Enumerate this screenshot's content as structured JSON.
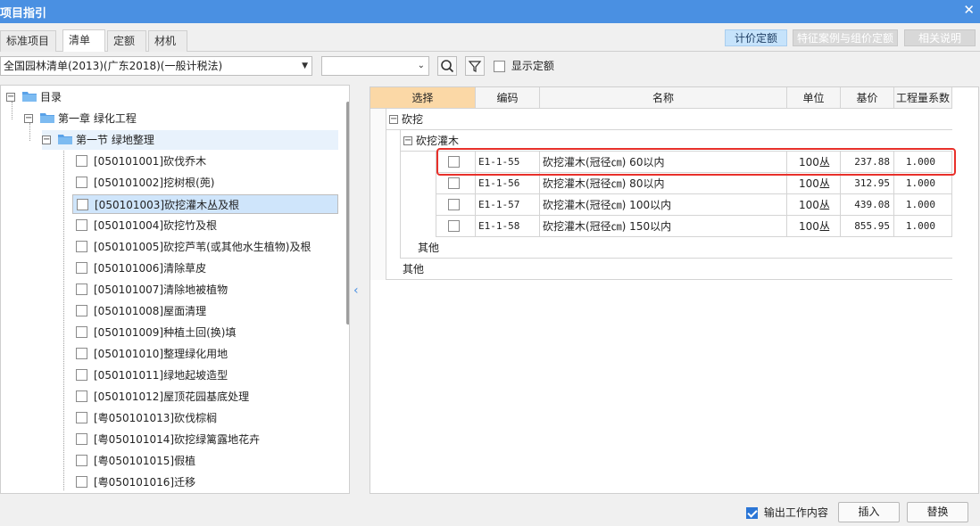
{
  "window": {
    "title": "项目指引",
    "close_icon": "close-icon"
  },
  "tabs": [
    {
      "label": "标准项目",
      "active": false
    },
    {
      "label": "清单",
      "active": true
    },
    {
      "label": "定额",
      "active": false
    },
    {
      "label": "材机",
      "active": false
    }
  ],
  "top_buttons": [
    {
      "label": "计价定额",
      "active": true
    },
    {
      "label": "特征案例与组价定额",
      "active": false
    },
    {
      "label": "相关说明",
      "active": false
    }
  ],
  "toolbar": {
    "library_select": "全国园林清单(2013)(广东2018)(一般计税法)",
    "secondary_select": "",
    "search_icon": "search-icon",
    "filter_icon": "filter-icon",
    "show_quota_label": "显示定额",
    "show_quota_checked": false
  },
  "tree": {
    "root": "目录",
    "chapter": "第一章 绿化工程",
    "section": "第一节 绿地整理",
    "items": [
      "[050101001]砍伐乔木",
      "[050101002]挖树根(蔸)",
      "[050101003]砍挖灌木丛及根",
      "[050101004]砍挖竹及根",
      "[050101005]砍挖芦苇(或其他水生植物)及根",
      "[050101006]清除草皮",
      "[050101007]清除地被植物",
      "[050101008]屋面清理",
      "[050101009]种植土回(换)填",
      "[050101010]整理绿化用地",
      "[050101011]绿地起坡造型",
      "[050101012]屋顶花园基底处理",
      "[粤050101013]砍伐棕榈",
      "[粤050101014]砍挖绿篱露地花卉",
      "[粤050101015]假植",
      "[粤050101016]迁移"
    ],
    "selected_index": 2
  },
  "grid": {
    "columns": [
      "选择",
      "编码",
      "名称",
      "单位",
      "基价",
      "工程量系数"
    ],
    "group_1": "砍挖",
    "group_1_1": "砍挖灌木",
    "rows": [
      {
        "code": "E1-1-55",
        "name": "砍挖灌木(冠径㎝) 60以内",
        "unit": "100丛",
        "price": "237.88",
        "factor": "1.000"
      },
      {
        "code": "E1-1-56",
        "name": "砍挖灌木(冠径㎝) 80以内",
        "unit": "100丛",
        "price": "312.95",
        "factor": "1.000"
      },
      {
        "code": "E1-1-57",
        "name": "砍挖灌木(冠径㎝) 100以内",
        "unit": "100丛",
        "price": "439.08",
        "factor": "1.000"
      },
      {
        "code": "E1-1-58",
        "name": "砍挖灌木(冠径㎝) 150以内",
        "unit": "100丛",
        "price": "855.95",
        "factor": "1.000"
      }
    ],
    "other_inner": "其他",
    "other_outer": "其他"
  },
  "bottom": {
    "output_work_label": "输出工作内容",
    "output_work_checked": true,
    "insert_label": "插入",
    "replace_label": "替换"
  },
  "colors": {
    "titlebar": "#4a90e2",
    "active_header": "#fbd8a6",
    "selection": "#cfe5fb",
    "highlight": "#e8302a"
  }
}
